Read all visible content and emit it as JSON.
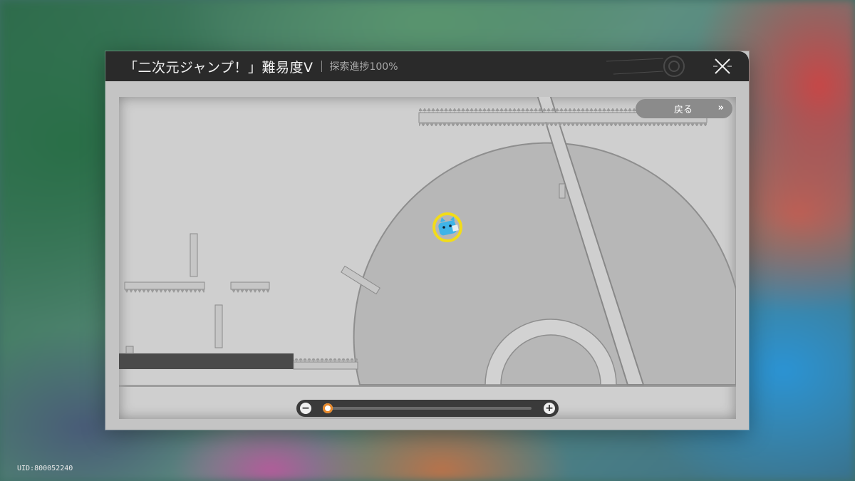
{
  "window": {
    "title": "「二次元ジャンプ！」難易度V",
    "progress": "探索進捗100%"
  },
  "map": {
    "back_label": "戻る",
    "back_chevron": "»",
    "player_marker": "cat-player-icon",
    "zoom": {
      "minus": "−",
      "plus": "+",
      "level": 0.0
    }
  },
  "footer": {
    "uid": "UID:800052240"
  },
  "colors": {
    "header_bg": "#2a2a2a",
    "map_bg": "#cfcfcf",
    "marker_ring": "#f2dc1a",
    "cat": "#3fb4e8",
    "zoom_thumb": "#e8892a"
  }
}
